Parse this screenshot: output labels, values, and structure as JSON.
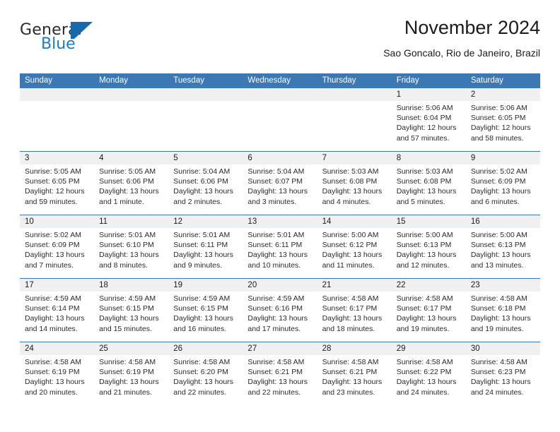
{
  "brand": {
    "name_top": "General",
    "name_bottom": "Blue",
    "mark": "triangle-logo",
    "color_blue": "#1769ad",
    "color_text": "#2b2b2b"
  },
  "header": {
    "title": "November 2024",
    "subtitle": "Sao Goncalo, Rio de Janeiro, Brazil"
  },
  "theme": {
    "header_blue": "#3b78b4",
    "daynum_band": "#f0f0f0",
    "cell_bg": "#ffffff",
    "text": "#2a2a2a"
  },
  "calendar": {
    "weekday_headers": [
      "Sunday",
      "Monday",
      "Tuesday",
      "Wednesday",
      "Thursday",
      "Friday",
      "Saturday"
    ],
    "weeks": [
      [
        {
          "day": "",
          "lines": [],
          "empty": true
        },
        {
          "day": "",
          "lines": [],
          "empty": true
        },
        {
          "day": "",
          "lines": [],
          "empty": true
        },
        {
          "day": "",
          "lines": [],
          "empty": true
        },
        {
          "day": "",
          "lines": [],
          "empty": true
        },
        {
          "day": "1",
          "lines": [
            "Sunrise: 5:06 AM",
            "Sunset: 6:04 PM",
            "Daylight: 12 hours",
            "and 57 minutes."
          ],
          "empty": false
        },
        {
          "day": "2",
          "lines": [
            "Sunrise: 5:06 AM",
            "Sunset: 6:05 PM",
            "Daylight: 12 hours",
            "and 58 minutes."
          ],
          "empty": false
        }
      ],
      [
        {
          "day": "3",
          "lines": [
            "Sunrise: 5:05 AM",
            "Sunset: 6:05 PM",
            "Daylight: 12 hours",
            "and 59 minutes."
          ],
          "empty": false
        },
        {
          "day": "4",
          "lines": [
            "Sunrise: 5:05 AM",
            "Sunset: 6:06 PM",
            "Daylight: 13 hours",
            "and 1 minute."
          ],
          "empty": false
        },
        {
          "day": "5",
          "lines": [
            "Sunrise: 5:04 AM",
            "Sunset: 6:06 PM",
            "Daylight: 13 hours",
            "and 2 minutes."
          ],
          "empty": false
        },
        {
          "day": "6",
          "lines": [
            "Sunrise: 5:04 AM",
            "Sunset: 6:07 PM",
            "Daylight: 13 hours",
            "and 3 minutes."
          ],
          "empty": false
        },
        {
          "day": "7",
          "lines": [
            "Sunrise: 5:03 AM",
            "Sunset: 6:08 PM",
            "Daylight: 13 hours",
            "and 4 minutes."
          ],
          "empty": false
        },
        {
          "day": "8",
          "lines": [
            "Sunrise: 5:03 AM",
            "Sunset: 6:08 PM",
            "Daylight: 13 hours",
            "and 5 minutes."
          ],
          "empty": false
        },
        {
          "day": "9",
          "lines": [
            "Sunrise: 5:02 AM",
            "Sunset: 6:09 PM",
            "Daylight: 13 hours",
            "and 6 minutes."
          ],
          "empty": false
        }
      ],
      [
        {
          "day": "10",
          "lines": [
            "Sunrise: 5:02 AM",
            "Sunset: 6:09 PM",
            "Daylight: 13 hours",
            "and 7 minutes."
          ],
          "empty": false
        },
        {
          "day": "11",
          "lines": [
            "Sunrise: 5:01 AM",
            "Sunset: 6:10 PM",
            "Daylight: 13 hours",
            "and 8 minutes."
          ],
          "empty": false
        },
        {
          "day": "12",
          "lines": [
            "Sunrise: 5:01 AM",
            "Sunset: 6:11 PM",
            "Daylight: 13 hours",
            "and 9 minutes."
          ],
          "empty": false
        },
        {
          "day": "13",
          "lines": [
            "Sunrise: 5:01 AM",
            "Sunset: 6:11 PM",
            "Daylight: 13 hours",
            "and 10 minutes."
          ],
          "empty": false
        },
        {
          "day": "14",
          "lines": [
            "Sunrise: 5:00 AM",
            "Sunset: 6:12 PM",
            "Daylight: 13 hours",
            "and 11 minutes."
          ],
          "empty": false
        },
        {
          "day": "15",
          "lines": [
            "Sunrise: 5:00 AM",
            "Sunset: 6:13 PM",
            "Daylight: 13 hours",
            "and 12 minutes."
          ],
          "empty": false
        },
        {
          "day": "16",
          "lines": [
            "Sunrise: 5:00 AM",
            "Sunset: 6:13 PM",
            "Daylight: 13 hours",
            "and 13 minutes."
          ],
          "empty": false
        }
      ],
      [
        {
          "day": "17",
          "lines": [
            "Sunrise: 4:59 AM",
            "Sunset: 6:14 PM",
            "Daylight: 13 hours",
            "and 14 minutes."
          ],
          "empty": false
        },
        {
          "day": "18",
          "lines": [
            "Sunrise: 4:59 AM",
            "Sunset: 6:15 PM",
            "Daylight: 13 hours",
            "and 15 minutes."
          ],
          "empty": false
        },
        {
          "day": "19",
          "lines": [
            "Sunrise: 4:59 AM",
            "Sunset: 6:15 PM",
            "Daylight: 13 hours",
            "and 16 minutes."
          ],
          "empty": false
        },
        {
          "day": "20",
          "lines": [
            "Sunrise: 4:59 AM",
            "Sunset: 6:16 PM",
            "Daylight: 13 hours",
            "and 17 minutes."
          ],
          "empty": false
        },
        {
          "day": "21",
          "lines": [
            "Sunrise: 4:58 AM",
            "Sunset: 6:17 PM",
            "Daylight: 13 hours",
            "and 18 minutes."
          ],
          "empty": false
        },
        {
          "day": "22",
          "lines": [
            "Sunrise: 4:58 AM",
            "Sunset: 6:17 PM",
            "Daylight: 13 hours",
            "and 19 minutes."
          ],
          "empty": false
        },
        {
          "day": "23",
          "lines": [
            "Sunrise: 4:58 AM",
            "Sunset: 6:18 PM",
            "Daylight: 13 hours",
            "and 19 minutes."
          ],
          "empty": false
        }
      ],
      [
        {
          "day": "24",
          "lines": [
            "Sunrise: 4:58 AM",
            "Sunset: 6:19 PM",
            "Daylight: 13 hours",
            "and 20 minutes."
          ],
          "empty": false
        },
        {
          "day": "25",
          "lines": [
            "Sunrise: 4:58 AM",
            "Sunset: 6:19 PM",
            "Daylight: 13 hours",
            "and 21 minutes."
          ],
          "empty": false
        },
        {
          "day": "26",
          "lines": [
            "Sunrise: 4:58 AM",
            "Sunset: 6:20 PM",
            "Daylight: 13 hours",
            "and 22 minutes."
          ],
          "empty": false
        },
        {
          "day": "27",
          "lines": [
            "Sunrise: 4:58 AM",
            "Sunset: 6:21 PM",
            "Daylight: 13 hours",
            "and 22 minutes."
          ],
          "empty": false
        },
        {
          "day": "28",
          "lines": [
            "Sunrise: 4:58 AM",
            "Sunset: 6:21 PM",
            "Daylight: 13 hours",
            "and 23 minutes."
          ],
          "empty": false
        },
        {
          "day": "29",
          "lines": [
            "Sunrise: 4:58 AM",
            "Sunset: 6:22 PM",
            "Daylight: 13 hours",
            "and 24 minutes."
          ],
          "empty": false
        },
        {
          "day": "30",
          "lines": [
            "Sunrise: 4:58 AM",
            "Sunset: 6:23 PM",
            "Daylight: 13 hours",
            "and 24 minutes."
          ],
          "empty": false
        }
      ]
    ]
  }
}
